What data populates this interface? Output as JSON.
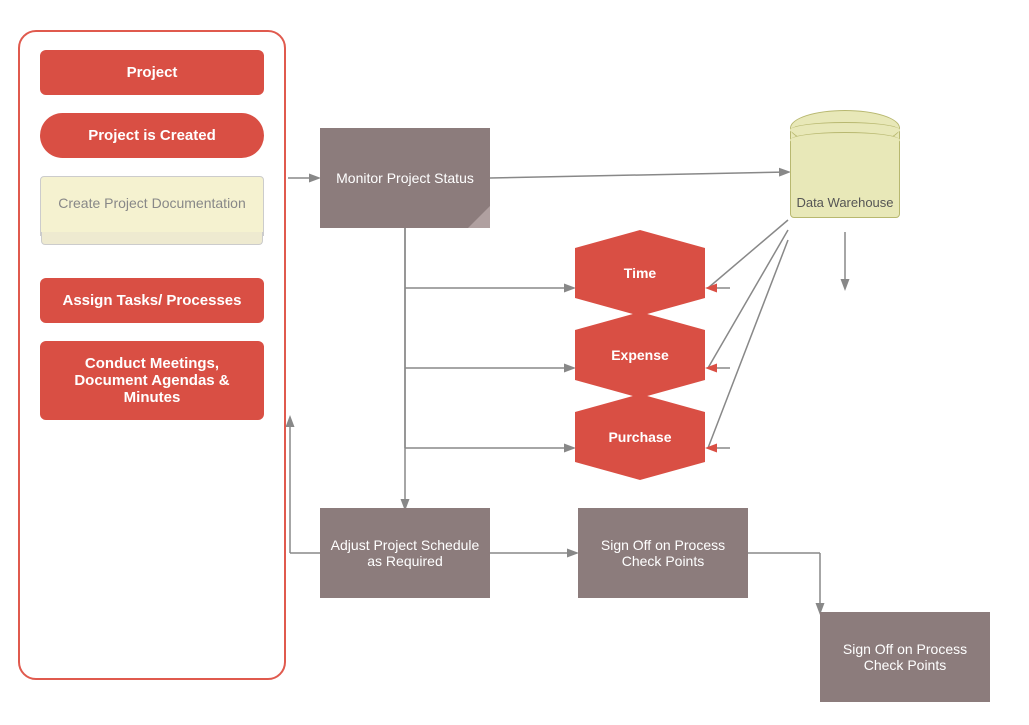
{
  "leftPanel": {
    "title": "Project",
    "items": [
      {
        "id": "created",
        "text": "Project is Created",
        "type": "rounded"
      },
      {
        "id": "documentation",
        "text": "Create Project Documentation",
        "type": "doc"
      },
      {
        "id": "assign",
        "text": "Assign Tasks/ Processes",
        "type": "rect"
      },
      {
        "id": "conduct",
        "text": "Conduct Meetings, Document Agendas & Minutes",
        "type": "rect"
      }
    ]
  },
  "flowBoxes": {
    "monitor": "Monitor Project Status",
    "adjust": "Adjust Project Schedule as Required",
    "signoff1": "Sign Off on Process Check Points",
    "signoff2": "Sign Off on Process Check Points"
  },
  "hexagons": {
    "time": "Time",
    "expense": "Expense",
    "purchase": "Purchase"
  },
  "dataWarehouse": {
    "label": "Data Warehouse"
  },
  "colors": {
    "red": "#d94f44",
    "grayBox": "#8c7c7c",
    "cylinder": "#e8e8b8",
    "panelBorder": "#e05a4e"
  }
}
